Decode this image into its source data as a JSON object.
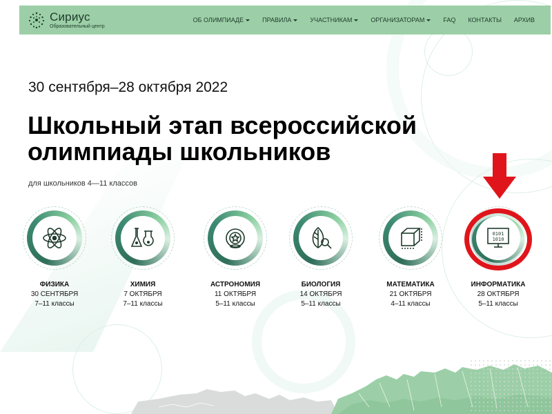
{
  "header": {
    "logo_name": "Сириус",
    "logo_sub": "Образовательный центр",
    "nav": [
      {
        "label": "ОБ ОЛИМПИАДЕ",
        "dropdown": true
      },
      {
        "label": "ПРАВИЛА",
        "dropdown": true
      },
      {
        "label": "УЧАСТНИКАМ",
        "dropdown": true
      },
      {
        "label": "ОРГАНИЗАТОРАМ",
        "dropdown": true
      },
      {
        "label": "FAQ",
        "dropdown": false
      },
      {
        "label": "КОНТАКТЫ",
        "dropdown": false
      },
      {
        "label": "АРХИВ",
        "dropdown": false
      }
    ]
  },
  "hero": {
    "dates": "30 сентября–28 октября 2022",
    "title_line1": "Школьный этап всероссийской",
    "title_line2": "олимпиады школьников",
    "subtitle": "для школьников 4—11 классов"
  },
  "subjects": [
    {
      "name": "ФИЗИКА",
      "date": "30 СЕНТЯБРЯ",
      "classes": "7–11 классы",
      "icon": "atom-icon"
    },
    {
      "name": "ХИМИЯ",
      "date": "7 ОКТЯБРЯ",
      "classes": "7–11 классы",
      "icon": "flask-icon"
    },
    {
      "name": "АСТРОНОМИЯ",
      "date": "11 ОКТЯБРЯ",
      "classes": "5–11 классы",
      "icon": "planet-icon"
    },
    {
      "name": "БИОЛОГИЯ",
      "date": "14 ОКТЯБРЯ",
      "classes": "5–11 классы",
      "icon": "leaf-magnifier-icon"
    },
    {
      "name": "МАТЕМАТИКА",
      "date": "21 ОКТЯБРЯ",
      "classes": "4–11 классы",
      "icon": "cube-icon"
    },
    {
      "name": "ИНФОРМАТИКА",
      "date": "28 ОКТЯБРЯ",
      "classes": "5–11 классы",
      "icon": "monitor-binary-icon"
    }
  ],
  "informatics_icon_text": {
    "line1": "0101",
    "line2": "1010"
  },
  "colors": {
    "header_bg": "#9ccfa7",
    "accent_dark": "#2f6e5a",
    "highlight_red": "#e0151b"
  }
}
